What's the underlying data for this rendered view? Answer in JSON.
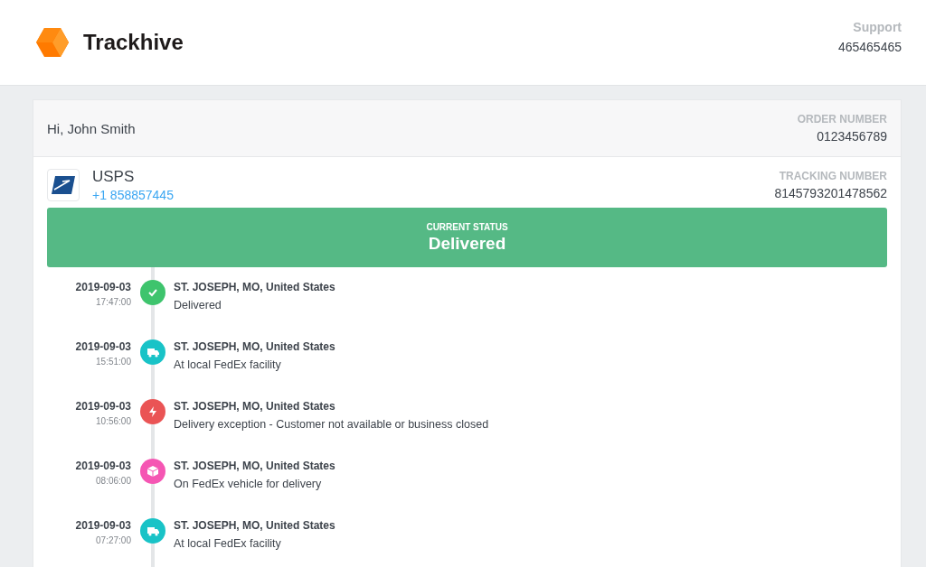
{
  "brand": {
    "name": "Trackhive"
  },
  "support": {
    "label": "Support",
    "phone": "465465465"
  },
  "order": {
    "greeting": "Hi, John Smith",
    "number_label": "ORDER NUMBER",
    "number": "0123456789"
  },
  "carrier": {
    "name": "USPS",
    "phone": "+1 858857445",
    "tracking_label": "TRACKING NUMBER",
    "tracking_number": "8145793201478562"
  },
  "status": {
    "label": "CURRENT STATUS",
    "value": "Delivered"
  },
  "events": [
    {
      "date": "2019-09-03",
      "time": "17:47:00",
      "location": "ST. JOSEPH, MO, United States",
      "description": "Delivered",
      "kind": "check",
      "color": "#3ec46d"
    },
    {
      "date": "2019-09-03",
      "time": "15:51:00",
      "location": "ST. JOSEPH, MO, United States",
      "description": "At local FedEx facility",
      "kind": "truck",
      "color": "#19c3c7"
    },
    {
      "date": "2019-09-03",
      "time": "10:56:00",
      "location": "ST. JOSEPH, MO, United States",
      "description": "Delivery exception - Customer not available or business closed",
      "kind": "bolt",
      "color": "#ea5455"
    },
    {
      "date": "2019-09-03",
      "time": "08:06:00",
      "location": "ST. JOSEPH, MO, United States",
      "description": "On FedEx vehicle for delivery",
      "kind": "box",
      "color": "#f556b3"
    },
    {
      "date": "2019-09-03",
      "time": "07:27:00",
      "location": "ST. JOSEPH, MO, United States",
      "description": "At local FedEx facility",
      "kind": "truck",
      "color": "#19c3c7"
    }
  ]
}
